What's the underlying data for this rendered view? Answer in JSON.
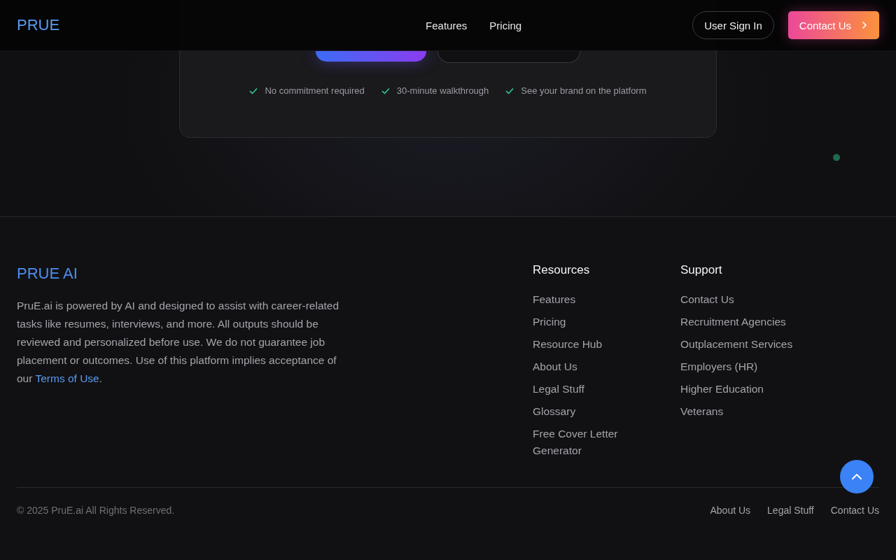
{
  "header": {
    "logo": "PRUE",
    "nav": [
      {
        "label": "Features"
      },
      {
        "label": "Pricing"
      }
    ],
    "sign_in": "User Sign In",
    "contact": "Contact Us"
  },
  "hero": {
    "checks": [
      "No commitment required",
      "30-minute walkthrough",
      "See your brand on the platform"
    ]
  },
  "footer": {
    "brand": "PRUE AI",
    "about": "PruE.ai is powered by AI and designed to assist with career-related tasks like resumes, interviews, and more. All outputs should be reviewed and personalized before use. We do not guarantee job placement or outcomes. Use of this platform implies acceptance of our ",
    "terms_link": "Terms of Use",
    "about_end": ".",
    "columns": [
      {
        "title": "Resources",
        "links": [
          "Features",
          "Pricing",
          "Resource Hub",
          "About Us",
          "Legal Stuff",
          "Glossary",
          "Free Cover Letter Generator"
        ]
      },
      {
        "title": "Support",
        "links": [
          "Contact Us",
          "Recruitment Agencies",
          "Outplacement Services",
          "Employers (HR)",
          "Higher Education",
          "Veterans"
        ]
      }
    ],
    "copyright": "© 2025 PruE.ai All Rights Reserved.",
    "bottom_links": [
      "About Us",
      "Legal Stuff",
      "Contact Us"
    ]
  }
}
